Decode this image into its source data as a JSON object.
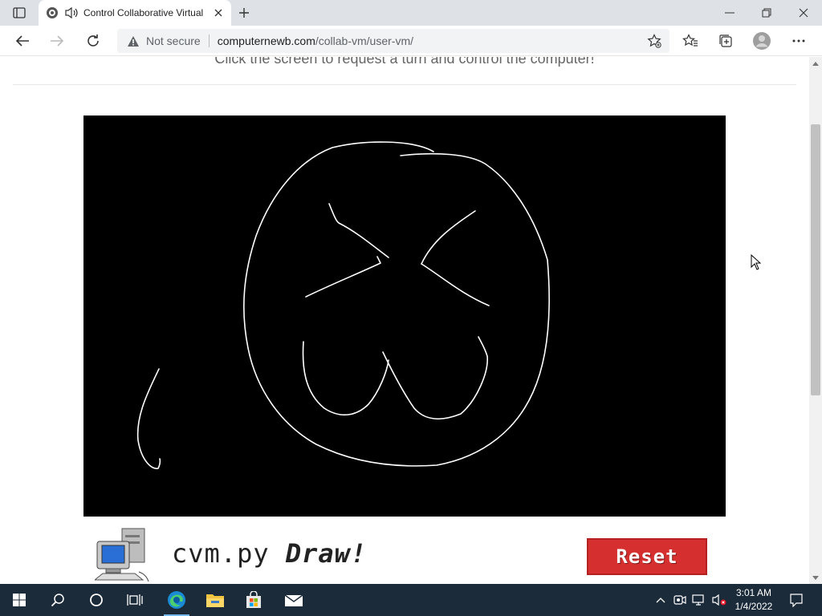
{
  "browser": {
    "tab_title": "Control Collaborative Virtual Machine",
    "address": {
      "security_label": "Not secure",
      "host": "computernewb.com",
      "path": "/collab-vm/user-vm/"
    }
  },
  "page": {
    "subtitle": "Click the screen to request a turn and control the computer!",
    "brand_prefix": "cvm.py",
    "brand_suffix": "Draw!",
    "reset_label": "Reset"
  },
  "taskbar": {
    "time": "3:01 AM",
    "date": "1/4/2022"
  },
  "colors": {
    "accent": "#d52f2f",
    "taskbar": "#1c2b3a",
    "canvas": "#000000"
  }
}
